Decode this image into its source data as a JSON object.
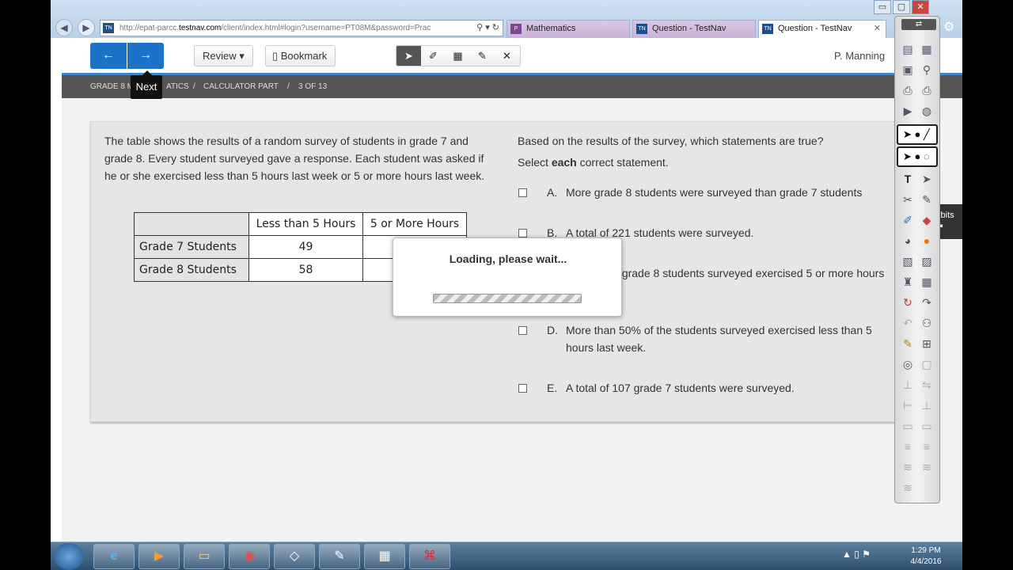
{
  "browser": {
    "url_prefix": "http://epat-parcc.",
    "url_domain": "testnav.com",
    "url_rest": "/client/index.html#login?username=PT08M&password=Prac",
    "addr_icons": "⚲ ▾ ↻",
    "favicon": "TN",
    "tabs": [
      {
        "label": "Mathematics",
        "icon": "P"
      },
      {
        "label": "Question - TestNav",
        "icon": "TN"
      },
      {
        "label": "Question - TestNav",
        "icon": "TN"
      }
    ],
    "window_buttons": [
      "▭",
      "▢",
      "✕"
    ]
  },
  "toolbar": {
    "prev_icon": "←",
    "next_icon": "→",
    "review_label": "Review ▾",
    "bookmark_label": "Bookmark",
    "tool_icons": [
      "pointer-icon",
      "eraser-icon",
      "calculator-icon",
      "highlighter-icon",
      "cross-out-icon"
    ],
    "tool_glyphs": [
      "➤",
      "✐",
      "▦",
      "✎",
      "✕"
    ],
    "user_name": "P. Manning",
    "tooltip": "Next"
  },
  "breadcrumb": {
    "subject": "GRADE 8 M",
    "subject_tail": "ATICS",
    "sep1": "/",
    "section": "CALCULATOR PART",
    "sep2": "/",
    "progress": "3 OF 13"
  },
  "question": {
    "passage": "The table shows the results of a random survey of students in grade 7 and grade 8. Every student surveyed gave a response. Each student was asked if he or she exercised less than 5 hours last week or 5 or more hours last week.",
    "table": {
      "headers": [
        "",
        "Less than 5 Hours",
        "5 or More Hours"
      ],
      "rows": [
        {
          "label": "Grade 7 Students",
          "lt5": "49",
          "ge5": ""
        },
        {
          "label": "Grade 8 Students",
          "lt5": "58",
          "ge5": ""
        }
      ]
    },
    "prompt": "Based on the results of the survey, which statements are true?",
    "instruction_pre": "Select ",
    "instruction_bold": "each",
    "instruction_post": " correct statement.",
    "options": [
      {
        "letter": "A.",
        "text": "More grade 8 students were surveyed than grade 7 students"
      },
      {
        "letter": "B.",
        "text": "A total of 221 students were surveyed."
      },
      {
        "letter": "C.",
        "text": "50% of the grade 8 students surveyed exercised 5 or more hours last week."
      },
      {
        "letter": "D.",
        "text": "More than 50% of the students surveyed exercised less than 5 hours last week."
      },
      {
        "letter": "E.",
        "text": "A total of 107 grade 7 students were surveyed."
      }
    ]
  },
  "dialog": {
    "loading_text": "Loading, please wait..."
  },
  "exhibits_label": "nibits",
  "taskbar": {
    "apps": [
      "e",
      "▶",
      "▭",
      "◉",
      "◇",
      "✎",
      "▦",
      "⌘"
    ],
    "tray_icons": "▲ ▯ ⚑",
    "time": "1:29 PM",
    "date": "4/4/2016"
  }
}
